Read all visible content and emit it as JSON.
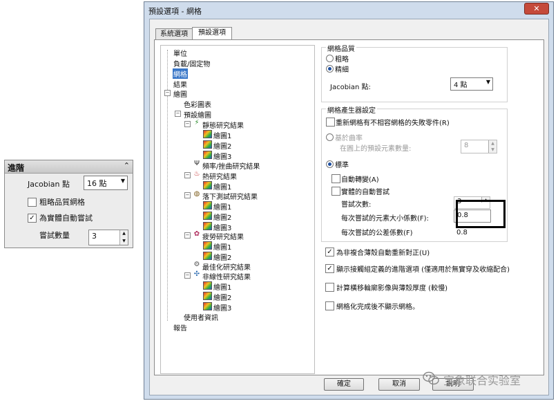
{
  "advanced_panel": {
    "title": "進階",
    "collapse_glyph": "⌃",
    "jacobian_label": "Jacobian 點",
    "jacobian_value": "16 點",
    "coarse_label": "粗略品質網格",
    "coarse_checked": false,
    "auto_label": "為實體自動嘗試",
    "auto_checked": true,
    "tries_label": "嘗試數量",
    "tries_value": "3"
  },
  "dialog": {
    "title": "預設選項 - 網格",
    "close_glyph": "✕",
    "tabs": [
      "系統選項",
      "預設選項"
    ],
    "tree": {
      "units": "單位",
      "loads": "負載/固定物",
      "mesh": "網格",
      "results": "結果",
      "plot": "繪圖",
      "color_chart": "色彩圖表",
      "default_plots": "預設繪圖",
      "static": "靜態研究結果",
      "plot1": "繪圖1",
      "plot2": "繪圖2",
      "plot3": "繪圖3",
      "frequency": "頻率/挫曲研究結果",
      "thermal": "熱研究結果",
      "drop": "落下測試研究結果",
      "fatigue": "疲勞研究結果",
      "optimization": "最佳化研究結果",
      "nonlinear": "非線性研究結果",
      "user_info": "使用者資訊",
      "report": "報告"
    },
    "quality": {
      "legend": "網格品質",
      "coarse": "粗略",
      "fine": "精細",
      "jacobian_label": "Jacobian 點:",
      "jacobian_value": "4 點"
    },
    "mesher": {
      "legend": "網格產生器設定",
      "remesh_label": "重新網格有不相容網格的失敗零件(R)",
      "curvature_label": "基於曲率",
      "circle_label": "在圓上的預設元素數量:",
      "circle_value": "8",
      "standard_label": "標準",
      "auto_transition": "自動轉變(A)",
      "auto_try": "實體的自動嘗試",
      "tries_label": "嘗試次數:",
      "tries_value": "3",
      "elem_factor_label": "每次嘗試的元素大小係數(F):",
      "elem_factor_value": "0.8",
      "tol_factor_label": "每次嘗試的公差係數(F)",
      "tol_factor_value": "0.8"
    },
    "options": {
      "reorient": "為非複合薄殼自動重新對正(U)",
      "show_mate": "顯示接觸組定義的進階選項 (僅適用於無實穿及收縮配合)",
      "calc_thickness": "計算橫移輪廓影像與薄殼厚度 (較慢)",
      "no_show": "網格化完成後不顯示網格。"
    },
    "buttons": {
      "ok": "確定",
      "cancel": "取消",
      "help": "說明"
    }
  },
  "watermark": "宝象联合实验室",
  "colors": {
    "selection": "#3876c8",
    "highlight_box": "#000000",
    "dialog_frame": "#cfdcec"
  }
}
